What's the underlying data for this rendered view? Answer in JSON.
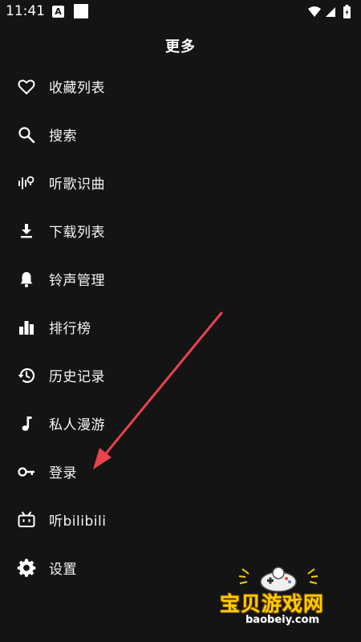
{
  "status_bar": {
    "time": "11:41",
    "notification_badge": "A"
  },
  "header": {
    "title": "更多"
  },
  "menu": {
    "items": [
      {
        "label": "收藏列表",
        "icon": "heart-icon"
      },
      {
        "label": "搜索",
        "icon": "search-icon"
      },
      {
        "label": "听歌识曲",
        "icon": "song-recognition-icon"
      },
      {
        "label": "下载列表",
        "icon": "download-icon"
      },
      {
        "label": "铃声管理",
        "icon": "bell-icon"
      },
      {
        "label": "排行榜",
        "icon": "bar-chart-icon"
      },
      {
        "label": "历史记录",
        "icon": "history-icon"
      },
      {
        "label": "私人漫游",
        "icon": "music-note-icon"
      },
      {
        "label": "登录",
        "icon": "key-icon"
      },
      {
        "label": "听bilibili",
        "icon": "tv-icon"
      },
      {
        "label": "设置",
        "icon": "gear-icon"
      }
    ]
  },
  "watermark": {
    "title": "宝贝游戏网",
    "url": "baobeiy.com"
  },
  "colors": {
    "background": "#141414",
    "text": "#f5f5f5",
    "arrow": "#e8434f",
    "watermark": "#ffcd00"
  }
}
